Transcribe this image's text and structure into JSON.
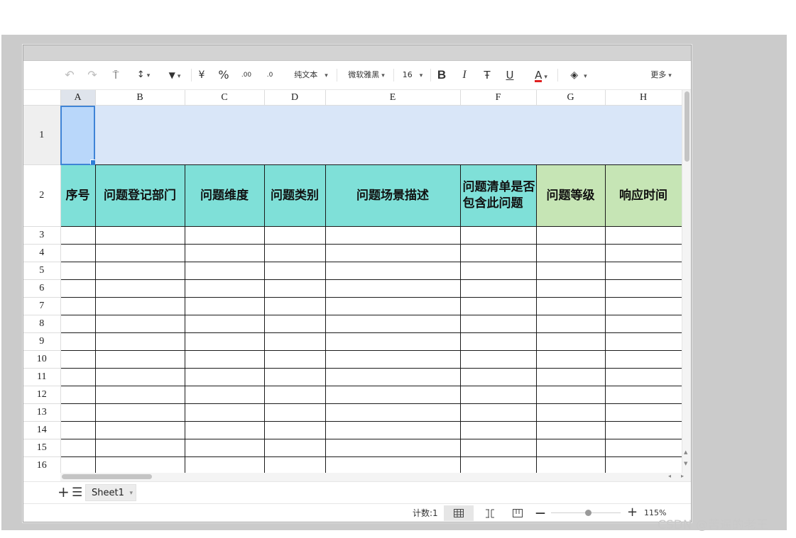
{
  "toolbar": {
    "undo": "↶",
    "redo": "↷",
    "format_painter": "⍑",
    "sort": "↕",
    "filter": "▼",
    "currency": "¥",
    "percent": "%",
    "decimal_inc": ".00",
    "decimal_dec": ".0",
    "number_format": "纯文本",
    "font_family": "微软雅黑",
    "font_size": "16",
    "bold": "B",
    "italic": "I",
    "strikethrough": "Ŧ",
    "underline": "U",
    "font_color": "A",
    "font_color_value": "#e02020",
    "fill": "◈",
    "more": "更多"
  },
  "grid": {
    "columns": [
      "A",
      "B",
      "C",
      "D",
      "E",
      "F",
      "G",
      "H"
    ],
    "rows": [
      "1",
      "2",
      "3",
      "4",
      "5",
      "6",
      "7",
      "8",
      "9",
      "10",
      "11",
      "12",
      "13",
      "14",
      "15",
      "16"
    ],
    "selected_cell": "A1",
    "header_cells": [
      "序号",
      "问题登记部门",
      "问题维度",
      "问题类别",
      "问题场景描述",
      "问题清单是否包含此问题",
      "问题等级",
      "响应时间"
    ],
    "colors": {
      "header_teal": "#7fe0d8",
      "header_green": "#c6e5b5",
      "row1_fill": "#d9e6f8",
      "selection": "#b9d7fa"
    }
  },
  "tabs": {
    "add": "+",
    "list": "☰",
    "sheets": [
      "Sheet1"
    ]
  },
  "status": {
    "count": "计数:1",
    "zoom_minus": "—",
    "zoom_plus": "+",
    "zoom": "115%"
  },
  "watermark": "CSDN @苦逼的老王"
}
